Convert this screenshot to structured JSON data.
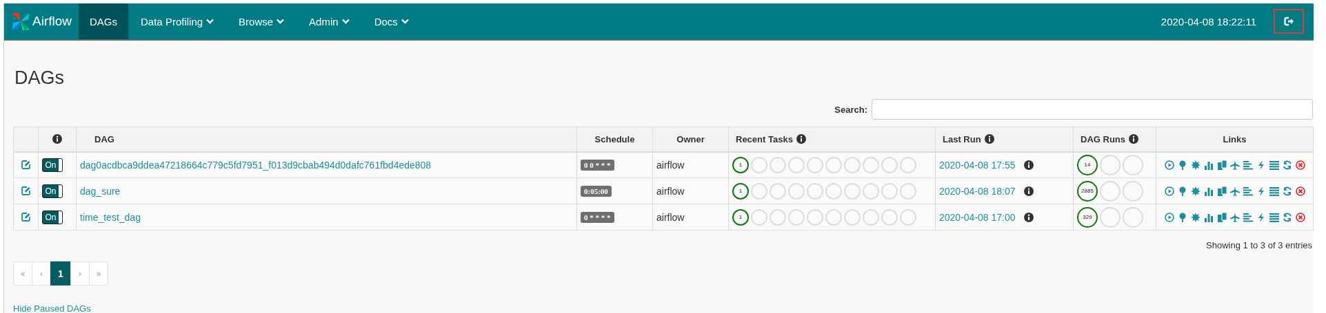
{
  "navbar": {
    "brand": "Airflow",
    "items": [
      {
        "label": "DAGs",
        "selected": true,
        "has_menu": false
      },
      {
        "label": "Data Profiling",
        "selected": false,
        "has_menu": true
      },
      {
        "label": "Browse",
        "selected": false,
        "has_menu": true
      },
      {
        "label": "Admin",
        "selected": false,
        "has_menu": true
      },
      {
        "label": "Docs",
        "selected": false,
        "has_menu": true
      }
    ],
    "clock": "2020-04-08 18:22:11"
  },
  "page_title": "DAGs",
  "search": {
    "label": "Search:"
  },
  "table": {
    "columns": [
      {
        "kind": "blank"
      },
      {
        "info": true,
        "kind": "icon"
      },
      {
        "label": "DAG",
        "info": false,
        "kind": "text"
      },
      {
        "label": "Schedule",
        "info": false,
        "kind": "text"
      },
      {
        "label": "Owner",
        "info": false,
        "kind": "text"
      },
      {
        "label": "Recent Tasks",
        "info": true,
        "kind": "text"
      },
      {
        "label": "Last Run",
        "info": true,
        "kind": "text"
      },
      {
        "label": "DAG Runs",
        "info": true,
        "kind": "text"
      },
      {
        "label": "Links",
        "info": false,
        "kind": "text"
      }
    ],
    "rows": [
      {
        "toggle": {
          "label": "On",
          "on": true
        },
        "dag": "dag0acdbca9ddea47218664c779c5fd7951_f013d9cbab494d0dafc761fbd4ede808",
        "schedule": "0 0 * * *",
        "owner": "airflow",
        "recent_tasks": [
          {
            "label": "1",
            "active": true
          },
          {
            "active": false
          },
          {
            "active": false
          },
          {
            "active": false
          },
          {
            "active": false
          },
          {
            "active": false
          },
          {
            "active": false
          },
          {
            "active": false
          },
          {
            "active": false
          },
          {
            "active": false
          }
        ],
        "last_run": "2020-04-08 17:55",
        "dag_runs": [
          {
            "label": "14",
            "active": true
          },
          {
            "active": false
          },
          {
            "active": false
          }
        ]
      },
      {
        "toggle": {
          "label": "On",
          "on": true
        },
        "dag": "dag_sure",
        "schedule": "0:05:00",
        "owner": "airflow",
        "recent_tasks": [
          {
            "label": "1",
            "active": true
          },
          {
            "active": false
          },
          {
            "active": false
          },
          {
            "active": false
          },
          {
            "active": false
          },
          {
            "active": false
          },
          {
            "active": false
          },
          {
            "active": false
          },
          {
            "active": false
          },
          {
            "active": false
          }
        ],
        "last_run": "2020-04-08 18:07",
        "dag_runs": [
          {
            "label": "2885",
            "active": true
          },
          {
            "active": false
          },
          {
            "active": false
          }
        ]
      },
      {
        "toggle": {
          "label": "On",
          "on": true
        },
        "dag": "time_test_dag",
        "schedule": "0 * * * *",
        "owner": "airflow",
        "recent_tasks": [
          {
            "label": "1",
            "active": true
          },
          {
            "active": false
          },
          {
            "active": false
          },
          {
            "active": false
          },
          {
            "active": false
          },
          {
            "active": false
          },
          {
            "active": false
          },
          {
            "active": false
          },
          {
            "active": false
          },
          {
            "active": false
          }
        ],
        "last_run": "2020-04-08 17:00",
        "dag_runs": [
          {
            "label": "329",
            "active": true
          },
          {
            "active": false
          },
          {
            "active": false
          }
        ]
      }
    ]
  },
  "entries_info": "Showing 1 to 3 of 3 entries",
  "pagination": [
    {
      "label": "«",
      "selected": false
    },
    {
      "label": "‹",
      "selected": false
    },
    {
      "label": "1",
      "selected": true
    },
    {
      "label": "›",
      "selected": false
    },
    {
      "label": "»",
      "selected": false
    }
  ],
  "footer_link": "Hide Paused DAGs"
}
